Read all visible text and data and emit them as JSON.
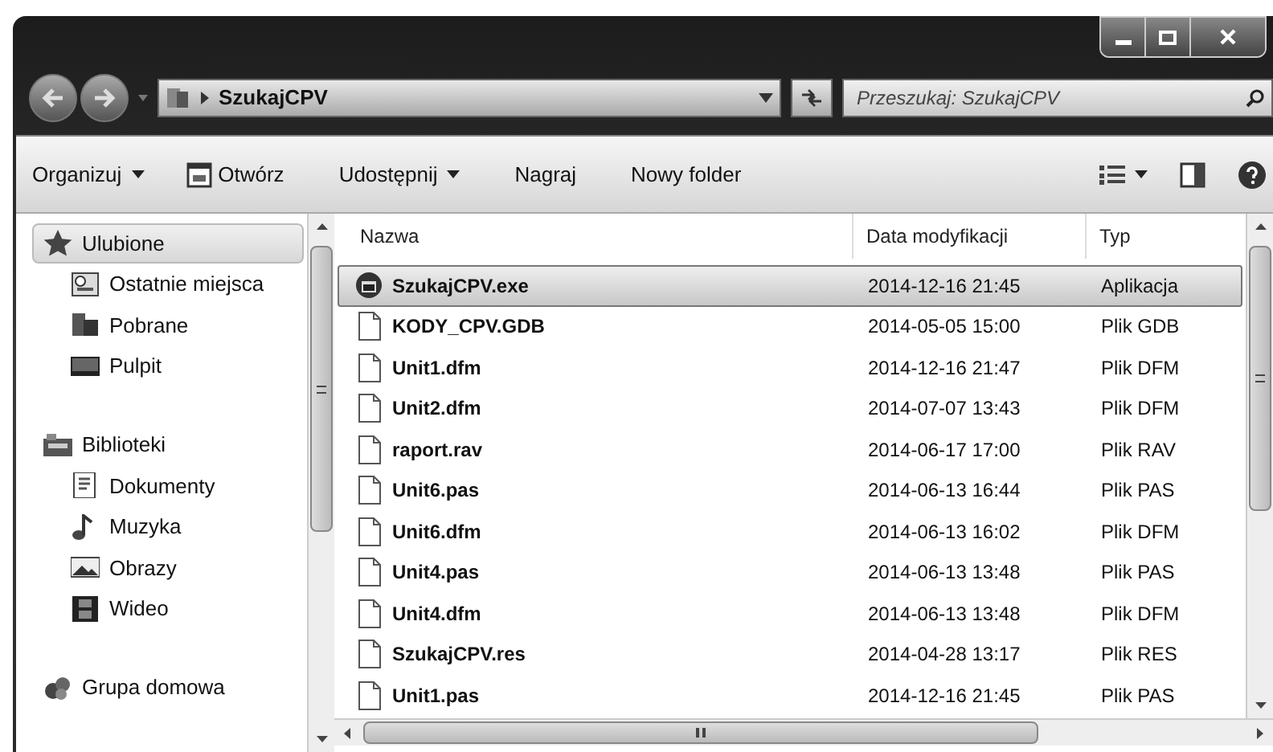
{
  "address": {
    "breadcrumb": "SzukajCPV"
  },
  "search": {
    "placeholder": "Przeszukaj: SzukajCPV"
  },
  "toolbar": [
    {
      "label": "Organizuj",
      "kind": "menu"
    },
    {
      "label": "Otwórz",
      "kind": "icon"
    },
    {
      "label": "Udostępnij",
      "kind": "menu"
    },
    {
      "label": "Nagraj",
      "kind": "plain"
    },
    {
      "label": "Nowy folder",
      "kind": "plain"
    }
  ],
  "sidebar": [
    {
      "label": "Ulubione",
      "selected": true,
      "children": [
        {
          "label": "Ostatnie miejsca"
        },
        {
          "label": "Pobrane"
        },
        {
          "label": "Pulpit"
        }
      ]
    },
    {
      "label": "Biblioteki",
      "selected": false,
      "children": [
        {
          "label": "Dokumenty"
        },
        {
          "label": "Muzyka"
        },
        {
          "label": "Obrazy"
        },
        {
          "label": "Wideo"
        }
      ]
    },
    {
      "label": "Grupa domowa",
      "selected": false
    }
  ],
  "table": {
    "columns": [
      "Nazwa",
      "Data modyfikacji",
      "Typ"
    ],
    "rows": [
      {
        "name": "SzukajCPV.exe",
        "date": "2014-12-16 21:45",
        "type": "Aplikacja",
        "kind": "application",
        "selected": true
      },
      {
        "name": "KODY_CPV.GDB",
        "date": "2014-05-05 15:00",
        "type": "Plik GDB",
        "kind": "file",
        "selected": false
      },
      {
        "name": "Unit1.dfm",
        "date": "2014-12-16 21:47",
        "type": "Plik DFM",
        "kind": "file",
        "selected": false
      },
      {
        "name": "Unit2.dfm",
        "date": "2014-07-07 13:43",
        "type": "Plik DFM",
        "kind": "file",
        "selected": false
      },
      {
        "name": "raport.rav",
        "date": "2014-06-17 17:00",
        "type": "Plik RAV",
        "kind": "file",
        "selected": false
      },
      {
        "name": "Unit6.pas",
        "date": "2014-06-13 16:44",
        "type": "Plik PAS",
        "kind": "file",
        "selected": false
      },
      {
        "name": "Unit6.dfm",
        "date": "2014-06-13 16:02",
        "type": "Plik DFM",
        "kind": "file",
        "selected": false
      },
      {
        "name": "Unit4.pas",
        "date": "2014-06-13 13:48",
        "type": "Plik PAS",
        "kind": "file",
        "selected": false
      },
      {
        "name": "Unit4.dfm",
        "date": "2014-06-13 13:48",
        "type": "Plik DFM",
        "kind": "file",
        "selected": false
      },
      {
        "name": "SzukajCPV.res",
        "date": "2014-04-28 13:17",
        "type": "Plik RES",
        "kind": "file",
        "selected": false
      },
      {
        "name": "Unit1.pas",
        "date": "2014-12-16 21:45",
        "type": "Plik PAS",
        "kind": "file",
        "selected": false
      }
    ]
  }
}
